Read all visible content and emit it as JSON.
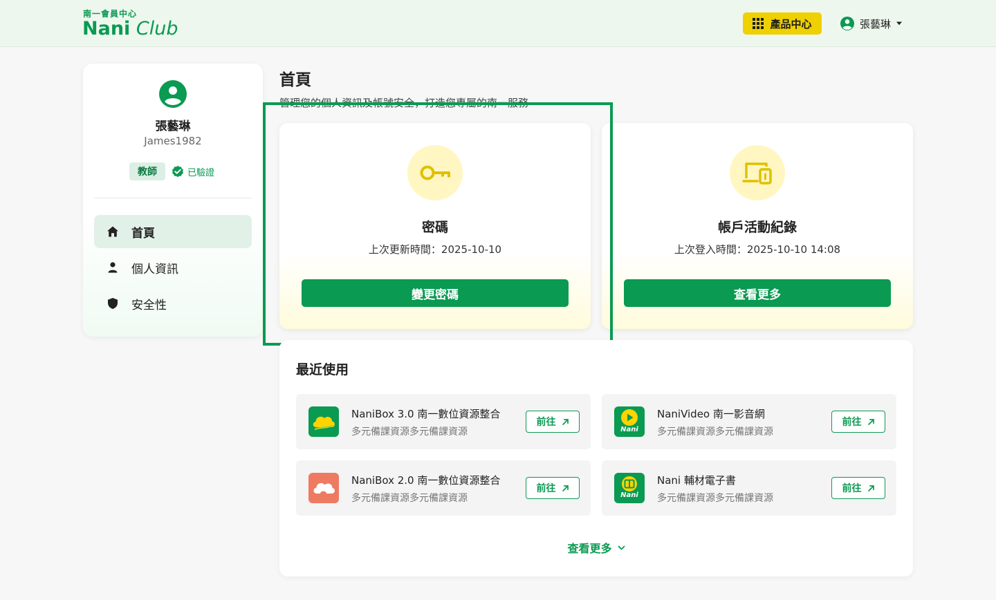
{
  "header": {
    "logo_small": "南一會員中心",
    "logo_main": "Nani",
    "logo_sub": "Club",
    "product_button": "產品中心",
    "user_name": "張藝琳"
  },
  "sidebar": {
    "name": "張藝琳",
    "user_id": "James1982",
    "role_badge": "教師",
    "verified_label": "已驗證",
    "items": [
      {
        "label": "首頁",
        "icon": "home-icon",
        "active": true
      },
      {
        "label": "個人資訊",
        "icon": "person-icon",
        "active": false
      },
      {
        "label": "安全性",
        "icon": "shield-icon",
        "active": false
      }
    ]
  },
  "main": {
    "title": "首頁",
    "subtitle": "管理您的個人資訊及帳號安全，打造您專屬的南一服務",
    "cards": [
      {
        "title": "密碼",
        "info": "上次更新時間：2025-10-10",
        "button": "變更密碼",
        "icon": "key-icon"
      },
      {
        "title": "帳戶活動紀錄",
        "info": "上次登入時間：2025-10-10 14:08",
        "button": "查看更多",
        "icon": "devices-icon"
      }
    ],
    "recent": {
      "title": "最近使用",
      "go_label": "前往",
      "items": [
        {
          "name": "NaniBox 3.0 南一數位資源整合",
          "desc": "多元備課資源多元備課資源",
          "icon": "nanibox3-icon"
        },
        {
          "name": "NaniVideo 南一影音網",
          "desc": "多元備課資源多元備課資源",
          "icon": "nanivideo-icon"
        },
        {
          "name": "NaniBox 2.0 南一數位資源整合",
          "desc": "多元備課資源多元備課資源",
          "icon": "nanibox2-icon"
        },
        {
          "name": "Nani 輔材電子書",
          "desc": "多元備課資源多元備課資源",
          "icon": "nani-ebook-icon"
        }
      ],
      "more_label": "查看更多"
    }
  },
  "colors": {
    "brand_green": "#0a9a52",
    "accent_yellow": "#efd000",
    "header_bg": "#eef7ee"
  }
}
